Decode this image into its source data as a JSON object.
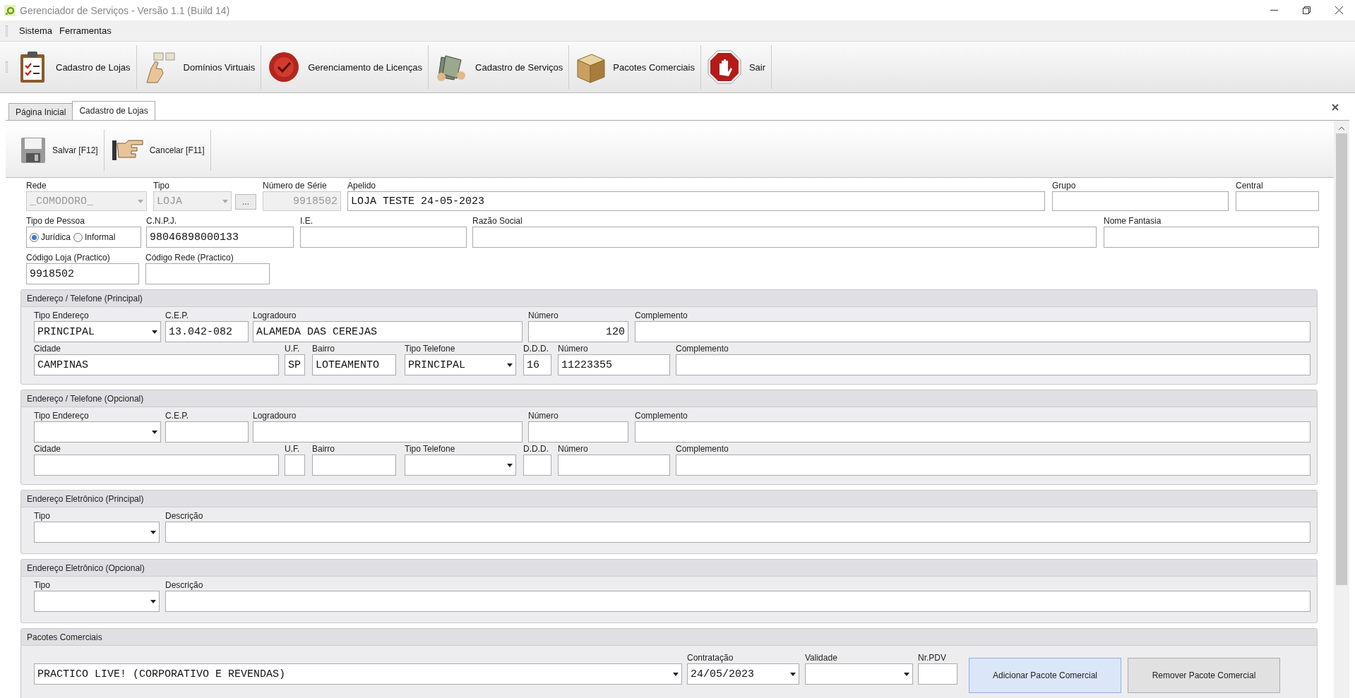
{
  "window": {
    "title": "Gerenciador de Serviços - Versão 1.1 (Build 14)"
  },
  "menu": [
    "Sistema",
    "Ferramentas"
  ],
  "toolbar": [
    {
      "label": "Cadastro de Lojas",
      "kind": "clipboard"
    },
    {
      "label": "Domínios Virtuais",
      "kind": "pointer"
    },
    {
      "label": "Gerenciamento de Licenças",
      "kind": "seal"
    },
    {
      "label": "Cadastro de Serviços",
      "kind": "folders"
    },
    {
      "label": "Pacotes Comerciais",
      "kind": "box"
    },
    {
      "label": "Sair",
      "kind": "stop"
    }
  ],
  "tabs": [
    {
      "label": "Página Inicial",
      "selected": false
    },
    {
      "label": "Cadastro de Lojas",
      "selected": true
    }
  ],
  "actions": [
    {
      "label": "Salvar [F12]",
      "kind": "disk"
    },
    {
      "label": "Cancelar [F11]",
      "kind": "hand"
    }
  ],
  "form_rows": [
    {
      "fields": [
        {
          "label": "Rede",
          "kind": "select",
          "value": "_COMODORO_",
          "disabled": true
        },
        {
          "label": "Tipo",
          "kind": "select",
          "value": "LOJA",
          "disabled": true
        },
        {
          "kind": "button",
          "value": "...",
          "disabled": false
        },
        {
          "label": "Número de Série",
          "kind": "numeric",
          "value": "9918502",
          "disabled": true
        },
        {
          "label": "Apelido",
          "kind": "text",
          "value": "LOJA TESTE 24-05-2023",
          "disabled": false
        },
        {
          "label": "Grupo",
          "kind": "text",
          "disabled": false
        },
        {
          "label": "Central",
          "kind": "text",
          "disabled": false
        }
      ]
    },
    {
      "fields": [
        {
          "label": "Tipo de Pessoa",
          "kind": "radios",
          "options": [
            {
              "label": "Jurídica",
              "selected": true
            },
            {
              "label": "Informal",
              "selected": false
            }
          ]
        },
        {
          "label": "C.N.P.J.",
          "kind": "text",
          "value": "98046898000133",
          "disabled": false
        },
        {
          "label": "I.E.",
          "kind": "text",
          "disabled": false
        },
        {
          "label": "Razão Social",
          "kind": "text",
          "disabled": false
        },
        {
          "label": "Nome Fantasia",
          "kind": "text",
          "disabled": false
        }
      ]
    },
    {
      "fields": [
        {
          "label": "Código Loja (Practico)",
          "kind": "text",
          "value": "9918502",
          "disabled": false
        },
        {
          "label": "Código Rede (Practico)",
          "kind": "text",
          "disabled": false
        }
      ]
    }
  ],
  "groups": [
    {
      "title": "Endereço / Telefone (Principal)",
      "kind": "address",
      "rows": [
        {
          "fields": [
            {
              "label": "Tipo Endereço",
              "kind": "select",
              "value": "PRINCIPAL"
            },
            {
              "label": "C.E.P.",
              "kind": "text",
              "value": "13.042-082"
            },
            {
              "label": "Logradouro",
              "kind": "text",
              "value": "ALAMEDA DAS CEREJAS"
            },
            {
              "label": "Número",
              "kind": "numeric",
              "value": "120"
            },
            {
              "label": "Complemento",
              "kind": "text"
            }
          ]
        },
        {
          "fields": [
            {
              "label": "Cidade",
              "kind": "text",
              "value": "CAMPINAS"
            },
            {
              "label": "U.F.",
              "kind": "text",
              "value": "SP"
            },
            {
              "label": "Bairro",
              "kind": "text",
              "value": "LOTEAMENTO"
            },
            {
              "label": "Tipo Telefone",
              "kind": "select",
              "value": "PRINCIPAL"
            },
            {
              "label": "D.D.D.",
              "kind": "text",
              "value": "16"
            },
            {
              "label": "Número",
              "kind": "text",
              "value": "11223355"
            },
            {
              "label": "Complemento",
              "kind": "text"
            }
          ]
        }
      ]
    },
    {
      "title": "Endereço / Telefone (Opcional)",
      "kind": "address",
      "rows": [
        {
          "fields": [
            {
              "label": "Tipo Endereço",
              "kind": "select"
            },
            {
              "label": "C.E.P.",
              "kind": "text"
            },
            {
              "label": "Logradouro",
              "kind": "text"
            },
            {
              "label": "Número",
              "kind": "numeric"
            },
            {
              "label": "Complemento",
              "kind": "text"
            }
          ]
        },
        {
          "fields": [
            {
              "label": "Cidade",
              "kind": "text"
            },
            {
              "label": "U.F.",
              "kind": "text"
            },
            {
              "label": "Bairro",
              "kind": "text"
            },
            {
              "label": "Tipo Telefone",
              "kind": "select"
            },
            {
              "label": "D.D.D.",
              "kind": "text"
            },
            {
              "label": "Número",
              "kind": "text"
            },
            {
              "label": "Complemento",
              "kind": "text"
            }
          ]
        }
      ]
    },
    {
      "title": "Endereço Eletrônico (Principal)",
      "kind": "email",
      "rows": [
        {
          "fields": [
            {
              "label": "Tipo",
              "kind": "select"
            },
            {
              "label": "Descrição",
              "kind": "text"
            }
          ]
        }
      ]
    },
    {
      "title": "Endereço Eletrônico (Opcional)",
      "kind": "email",
      "rows": [
        {
          "fields": [
            {
              "label": "Tipo",
              "kind": "select"
            },
            {
              "label": "Descrição",
              "kind": "text"
            }
          ]
        }
      ]
    },
    {
      "title": "Pacotes Comerciais",
      "kind": "packages",
      "rows": [
        {
          "fields": [
            {
              "kind": "select",
              "value": "PRACTICO LIVE! (CORPORATIVO E REVENDAS)"
            },
            {
              "label": "Contratação",
              "kind": "select",
              "value": "24/05/2023"
            },
            {
              "label": "Validade",
              "kind": "select"
            },
            {
              "label": "Nr.PDV",
              "kind": "text"
            },
            {
              "kind": "action",
              "value": "Adicionar Pacote Comercial",
              "highlighted": true
            },
            {
              "kind": "action",
              "value": "Remover Pacote Comercial",
              "highlighted": false
            }
          ]
        }
      ]
    }
  ]
}
